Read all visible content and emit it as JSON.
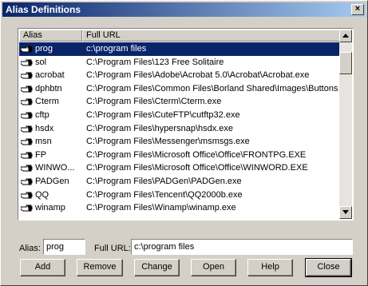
{
  "window": {
    "title": "Alias Definitions",
    "close_glyph": "×"
  },
  "list": {
    "columns": {
      "alias": "Alias",
      "url": "Full URL"
    },
    "selected_index": 0,
    "rows": [
      {
        "alias": "prog",
        "url": "c:\\program files"
      },
      {
        "alias": "sol",
        "url": "C:\\Program Files\\123 Free Solitaire"
      },
      {
        "alias": "acrobat",
        "url": "C:\\Program Files\\Adobe\\Acrobat 5.0\\Acrobat\\Acrobat.exe"
      },
      {
        "alias": "dphbtn",
        "url": "C:\\Program Files\\Common Files\\Borland Shared\\Images\\Buttons"
      },
      {
        "alias": "Cterm",
        "url": "C:\\Program Files\\Cterm\\Cterm.exe"
      },
      {
        "alias": "cftp",
        "url": "C:\\Program Files\\CuteFTP\\cutftp32.exe"
      },
      {
        "alias": "hsdx",
        "url": "C:\\Program Files\\hypersnap\\hsdx.exe"
      },
      {
        "alias": "msn",
        "url": "C:\\Program Files\\Messenger\\msmsgs.exe"
      },
      {
        "alias": "FP",
        "url": "C:\\Program Files\\Microsoft Office\\Office\\FRONTPG.EXE"
      },
      {
        "alias": "WINWO...",
        "url": "C:\\Program Files\\Microsoft Office\\Office\\WINWORD.EXE"
      },
      {
        "alias": "PADGen",
        "url": "C:\\Program Files\\PADGen\\PADGen.exe"
      },
      {
        "alias": "QQ",
        "url": "C:\\Program Files\\Tencent\\QQ2000b.exe"
      },
      {
        "alias": "winamp",
        "url": "C:\\Program Files\\Winamp\\winamp.exe"
      }
    ],
    "row_icon": "pointing-hand-icon"
  },
  "form": {
    "alias_label": "Alias:",
    "alias_value": "prog",
    "url_label": "Full URL:",
    "url_value": "c:\\program files"
  },
  "buttons": {
    "add": "Add",
    "remove": "Remove",
    "change": "Change",
    "open": "Open",
    "help": "Help",
    "close": "Close"
  },
  "colors": {
    "titlebar_start": "#0a246a",
    "titlebar_end": "#a6caf0",
    "selection": "#0a246a"
  }
}
